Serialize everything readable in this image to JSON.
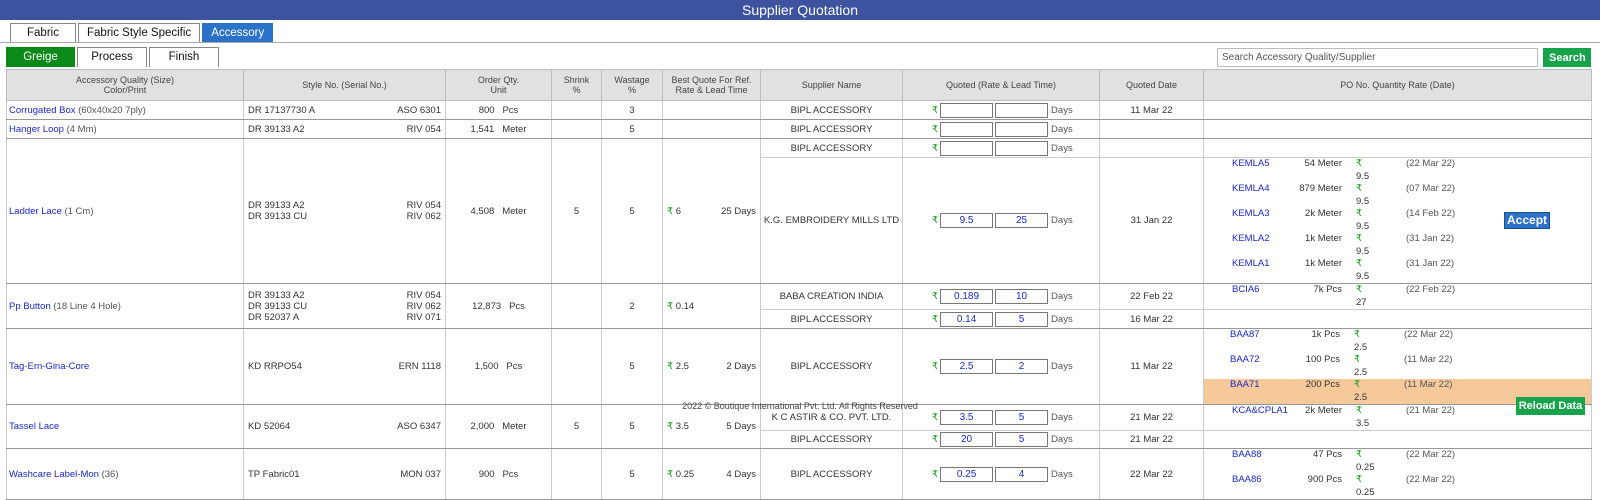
{
  "app": {
    "title": "Supplier Quotation"
  },
  "tabs_top": [
    {
      "label": "Fabric"
    },
    {
      "label": "Fabric Style Specific"
    },
    {
      "label": "Accessory"
    }
  ],
  "tabs_sub": [
    {
      "label": "Greige"
    },
    {
      "label": "Process"
    },
    {
      "label": "Finish"
    }
  ],
  "search": {
    "placeholder": "Search Accessory Quality/Supplier",
    "button_label": "Search"
  },
  "table": {
    "headers": {
      "quality_l1": "Accessory Quality (Size)",
      "quality_l2": "Color/Print",
      "style": "Style No. (Serial No.)",
      "order_l1": "Order Qty.",
      "order_l2": "Unit",
      "shrink_l1": "Shrink",
      "shrink_l2": "%",
      "wastage_l1": "Wastage",
      "wastage_l2": "%",
      "best_l1": "Best Quote For Ref.",
      "best_l2": "Rate & Lead Time",
      "supplier": "Supplier Name",
      "quoted": "Quoted (Rate & Lead Time)",
      "date": "Quoted Date",
      "po": "PO No. Quantity Rate (Date)"
    },
    "currency_symbol": "₹",
    "days_label": "Days",
    "accept_label": "Accept",
    "items": [
      {
        "name": "Corrugated Box",
        "size": "(60x40x20 7ply)",
        "styles": [
          {
            "no": "DR 17137730 A",
            "serial": "ASO 6301"
          }
        ],
        "qty": "800",
        "unit": "Pcs",
        "shrink": "",
        "wastage": "3",
        "best_rate": "",
        "best_days": "",
        "suppliers": [
          {
            "name": "BIPL ACCESSORY",
            "rate": "",
            "lead": "",
            "date": "11 Mar 22"
          }
        ]
      },
      {
        "name": "Hanger Loop",
        "size": "(4 Mm)",
        "styles": [
          {
            "no": "DR 39133 A2",
            "serial": "RIV 054"
          }
        ],
        "qty": "1,541",
        "unit": "Meter",
        "shrink": "",
        "wastage": "5",
        "best_rate": "",
        "best_days": "",
        "suppliers": [
          {
            "name": "BIPL ACCESSORY",
            "rate": "",
            "lead": "",
            "date": ""
          }
        ]
      },
      {
        "name": "Ladder Lace",
        "size": "(1 Cm)",
        "styles": [
          {
            "no": "DR 39133 A2",
            "serial": "RIV 054"
          },
          {
            "no": "DR 39133 CU",
            "serial": "RIV 062"
          }
        ],
        "qty": "4,508",
        "unit": "Meter",
        "shrink": "5",
        "wastage": "5",
        "best_rate": "6",
        "best_days": "25 Days",
        "suppliers": [
          {
            "name": "BIPL ACCESSORY",
            "rate": "",
            "lead": "",
            "date": ""
          },
          {
            "name": "K.G. EMBROIDERY MILLS LTD",
            "rate": "9.5",
            "lead": "25",
            "date": "31 Jan 22",
            "po": [
              {
                "no": "KEMLA5",
                "qty": "54 Meter",
                "rate": "9.5",
                "date": "(22 Mar 22)"
              },
              {
                "no": "KEMLA4",
                "qty": "879 Meter",
                "rate": "9.5",
                "date": "(07 Mar 22)"
              },
              {
                "no": "KEMLA3",
                "qty": "2k Meter",
                "rate": "9.5",
                "date": "(14 Feb 22)"
              },
              {
                "no": "KEMLA2",
                "qty": "1k Meter",
                "rate": "9.5",
                "date": "(31 Jan 22)"
              },
              {
                "no": "KEMLA1",
                "qty": "1k Meter",
                "rate": "9.5",
                "date": "(31 Jan 22)"
              }
            ]
          }
        ]
      },
      {
        "name": "Pp Button",
        "size": "(18 Line 4 Hole)",
        "styles": [
          {
            "no": "DR 39133 A2",
            "serial": "RIV 054"
          },
          {
            "no": "DR 39133 CU",
            "serial": "RIV 062"
          },
          {
            "no": "DR 52037 A",
            "serial": "RIV 071"
          }
        ],
        "qty": "12,873",
        "unit": "Pcs",
        "shrink": "",
        "wastage": "2",
        "best_rate": "0.14",
        "best_days": "",
        "suppliers": [
          {
            "name": "BABA CREATION INDIA",
            "rate": "0.189",
            "lead": "10",
            "date": "22 Feb 22",
            "po": [
              {
                "no": "BCIA6",
                "qty": "7k Pcs",
                "rate": "27",
                "date": "(22 Feb 22)"
              }
            ]
          },
          {
            "name": "BIPL ACCESSORY",
            "rate": "0.14",
            "lead": "5",
            "date": "16 Mar 22"
          }
        ]
      },
      {
        "name": "Tag-Ern-Gina-Core",
        "size": "",
        "styles": [
          {
            "no": "KD RRPO54",
            "serial": "ERN 1118"
          }
        ],
        "qty": "1,500",
        "unit": "Pcs",
        "shrink": "",
        "wastage": "5",
        "best_rate": "2.5",
        "best_days": "2 Days",
        "suppliers": [
          {
            "name": "BIPL ACCESSORY",
            "rate": "2.5",
            "lead": "2",
            "date": "11 Mar 22",
            "po": [
              {
                "no": "BAA87",
                "qty": "1k Pcs",
                "rate": "2.5",
                "date": "(22 Mar 22)"
              },
              {
                "no": "BAA72",
                "qty": "100 Pcs",
                "rate": "2.5",
                "date": "(11 Mar 22)"
              },
              {
                "no": "BAA71",
                "qty": "200 Pcs",
                "rate": "2.5",
                "date": "(11 Mar 22)",
                "highlight": true
              }
            ]
          }
        ]
      },
      {
        "name": "Tassel Lace",
        "size": "",
        "styles": [
          {
            "no": "KD 52064",
            "serial": "ASO 6347"
          }
        ],
        "qty": "2,000",
        "unit": "Meter",
        "shrink": "5",
        "wastage": "5",
        "best_rate": "3.5",
        "best_days": "5 Days",
        "suppliers": [
          {
            "name": "K C ASTIR & CO. PVT. LTD.",
            "rate": "3.5",
            "lead": "5",
            "date": "21 Mar 22",
            "po": [
              {
                "no": "KCA&CPLA1",
                "qty": "2k Meter",
                "rate": "3.5",
                "date": "(21 Mar 22)"
              }
            ]
          },
          {
            "name": "BIPL ACCESSORY",
            "rate": "20",
            "lead": "5",
            "date": "21 Mar 22"
          }
        ]
      },
      {
        "name": "Washcare Label-Mon",
        "size": "(36)",
        "styles": [
          {
            "no": "TP Fabric01",
            "serial": "MON 037"
          }
        ],
        "qty": "900",
        "unit": "Pcs",
        "shrink": "",
        "wastage": "5",
        "best_rate": "0.25",
        "best_days": "4 Days",
        "suppliers": [
          {
            "name": "BIPL ACCESSORY",
            "rate": "0.25",
            "lead": "4",
            "date": "22 Mar 22",
            "po": [
              {
                "no": "BAA88",
                "qty": "47 Pcs",
                "rate": "0.25",
                "date": "(22 Mar 22)"
              },
              {
                "no": "BAA86",
                "qty": "900 Pcs",
                "rate": "0.25",
                "date": "(22 Mar 22)"
              }
            ]
          }
        ]
      }
    ]
  },
  "footer": {
    "copyright": "2022 © Boutique International Pvt. Ltd. All Rights Reserved",
    "reload_label": "Reload Data"
  },
  "colors": {
    "title_bar": "#3d53a0",
    "tab_active": "#2a72c8",
    "subtab_active": "#0b8a1a",
    "button_green": "#17a34a",
    "link_blue": "#1a27c8",
    "po_highlight": "#f6c99a"
  }
}
